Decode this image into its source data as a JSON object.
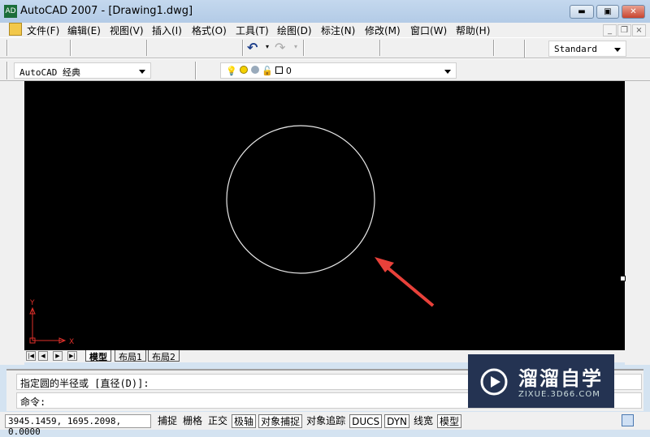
{
  "window": {
    "title": "AutoCAD 2007 - [Drawing1.dwg]",
    "app_icon": "acad"
  },
  "menu": [
    "文件(F)",
    "编辑(E)",
    "视图(V)",
    "插入(I)",
    "格式(O)",
    "工具(T)",
    "绘图(D)",
    "标注(N)",
    "修改(M)",
    "窗口(W)",
    "帮助(H)"
  ],
  "toolbar": {
    "style_select": "Standard",
    "workspace_select": "AutoCAD 经典",
    "layer_select": "0"
  },
  "layout_tabs": [
    "模型",
    "布局1",
    "布局2"
  ],
  "ucs": {
    "x": "X",
    "y": "Y"
  },
  "command": {
    "history": "指定圆的半径或 [直径(D)]:",
    "prompt": "命令:"
  },
  "status": {
    "coords": "3945.1459, 1695.2098, 0.0000",
    "buttons": [
      {
        "label": "捕捉",
        "on": false
      },
      {
        "label": "栅格",
        "on": false
      },
      {
        "label": "正交",
        "on": false
      },
      {
        "label": "极轴",
        "on": true
      },
      {
        "label": "对象捕捉",
        "on": true
      },
      {
        "label": "对象追踪",
        "on": false
      },
      {
        "label": "DUCS",
        "on": true
      },
      {
        "label": "DYN",
        "on": true
      },
      {
        "label": "线宽",
        "on": false
      },
      {
        "label": "模型",
        "on": true
      }
    ]
  },
  "watermark": {
    "name": "溜溜自学",
    "url": "ZIXUE.3D66.COM"
  },
  "colors": {
    "canvas": "#000000",
    "arrow": "#e8413a",
    "ucs": "#e0302a"
  }
}
